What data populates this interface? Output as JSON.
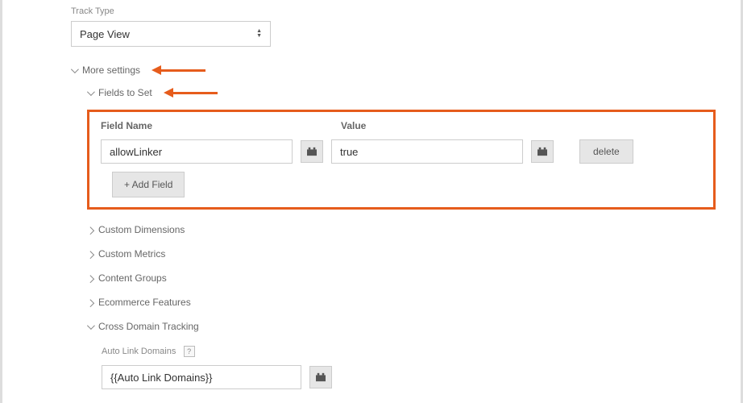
{
  "trackType": {
    "label": "Track Type",
    "value": "Page View"
  },
  "moreSettings": {
    "label": "More settings",
    "fieldsToSet": {
      "label": "Fields to Set",
      "columns": {
        "name": "Field Name",
        "value": "Value"
      },
      "rows": [
        {
          "name": "allowLinker",
          "value": "true"
        }
      ],
      "addLabel": "+ Add Field",
      "deleteLabel": "delete"
    },
    "customDimensions": {
      "label": "Custom Dimensions"
    },
    "customMetrics": {
      "label": "Custom Metrics"
    },
    "contentGroups": {
      "label": "Content Groups"
    },
    "ecommerceFeatures": {
      "label": "Ecommerce Features"
    },
    "crossDomain": {
      "label": "Cross Domain Tracking",
      "autoLink": {
        "label": "Auto Link Domains",
        "value": "{{Auto Link Domains}}"
      }
    }
  }
}
